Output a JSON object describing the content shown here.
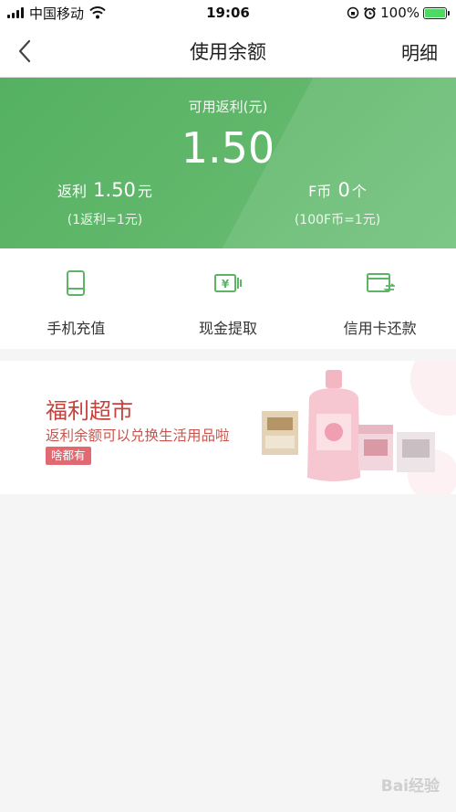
{
  "status_bar": {
    "carrier": "中国移动",
    "time": "19:06",
    "battery": "100%"
  },
  "nav": {
    "title": "使用余额",
    "detail_label": "明细"
  },
  "balance": {
    "label": "可用返利(元)",
    "amount": "1.50",
    "rebate_label": "返利",
    "rebate_value": "1.50",
    "rebate_unit": "元",
    "rebate_rate": "(1返利=1元)",
    "fcoin_label": "F币",
    "fcoin_value": "0",
    "fcoin_unit": "个",
    "fcoin_rate": "(100F币=1元)",
    "accent_color": "#5cb567"
  },
  "actions": [
    {
      "label": "手机充值",
      "icon": "phone-icon"
    },
    {
      "label": "现金提取",
      "icon": "cash-icon"
    },
    {
      "label": "信用卡还款",
      "icon": "credit-card-icon"
    }
  ],
  "banner": {
    "title": "福利超市",
    "subtitle": "返利余额可以兑换生活用品啦",
    "tag": "啥都有"
  },
  "watermark": "Bai经验"
}
